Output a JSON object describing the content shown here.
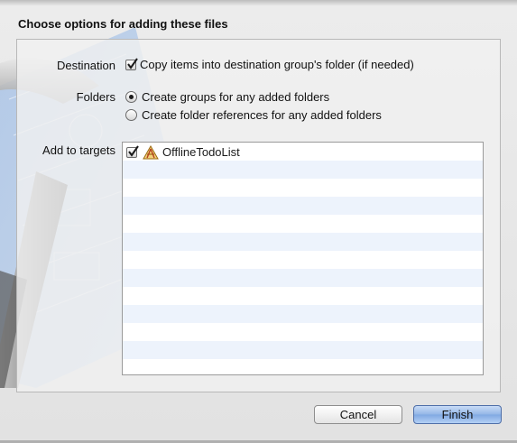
{
  "sheet": {
    "title": "Choose options for adding these files"
  },
  "options": {
    "destination_label": "Destination",
    "destination_checkbox_label": "Copy items into destination group's folder (if needed)",
    "destination_checked": true,
    "folders_label": "Folders",
    "folder_radio_groups_label": "Create groups for any added folders",
    "folder_radio_references_label": "Create folder references for any added folders",
    "folders_selected": "groups",
    "targets_label": "Add to targets"
  },
  "targets": {
    "items": [
      {
        "name": "OfflineTodoList",
        "checked": true,
        "icon": "app-target-icon"
      }
    ]
  },
  "buttons": {
    "cancel_label": "Cancel",
    "finish_label": "Finish"
  },
  "colors": {
    "default_button": "#93b6e7",
    "list_alternate_row": "#edf3fc"
  }
}
